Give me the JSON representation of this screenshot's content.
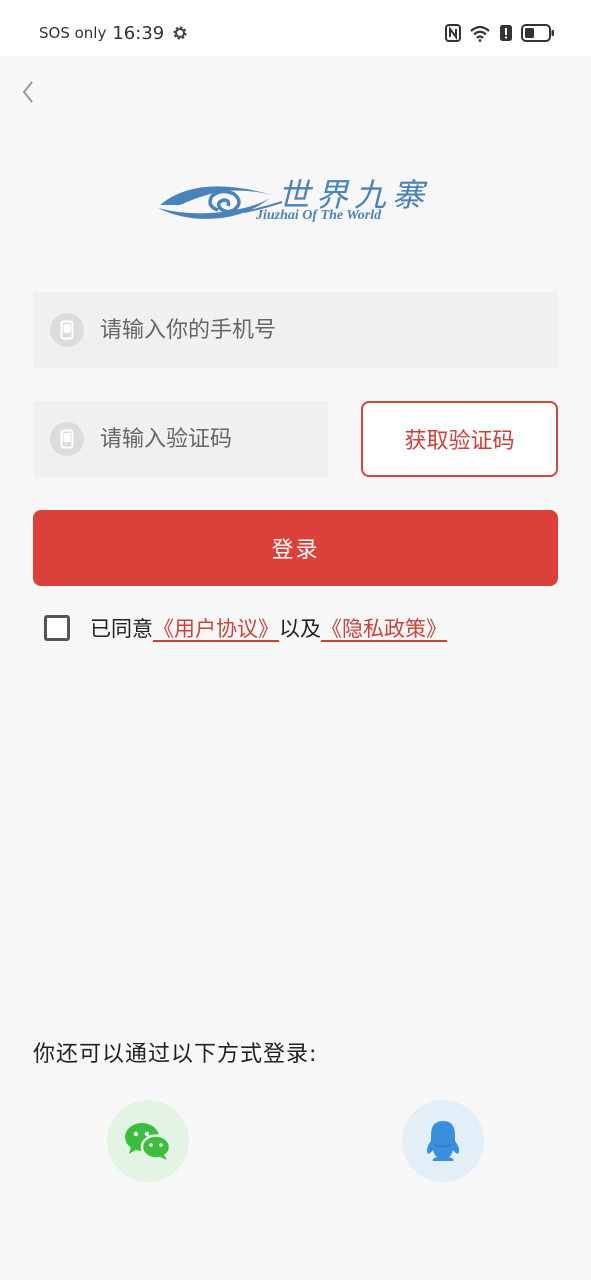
{
  "status_bar": {
    "carrier": "SOS only",
    "time": "16:39"
  },
  "logo": {
    "title": "世界九寨",
    "subtitle": "Jiuzhai Of The World"
  },
  "form": {
    "phone_placeholder": "请输入你的手机号",
    "code_placeholder": "请输入验证码",
    "get_code_label": "获取验证码",
    "login_label": "登录"
  },
  "agreement": {
    "prefix": "已同意",
    "user_agreement": "《用户协议》",
    "conjunction": "以及",
    "privacy_policy": "《隐私政策》",
    "checked": false
  },
  "alt_login": {
    "title": "你还可以通过以下方式登录:",
    "methods": [
      "wechat",
      "qq"
    ]
  },
  "colors": {
    "primary": "#dc403a",
    "link": "#c9443b",
    "logo_blue": "#4a83b9",
    "wechat_green": "#3dbd3d",
    "qq_blue": "#3a8fdc"
  }
}
